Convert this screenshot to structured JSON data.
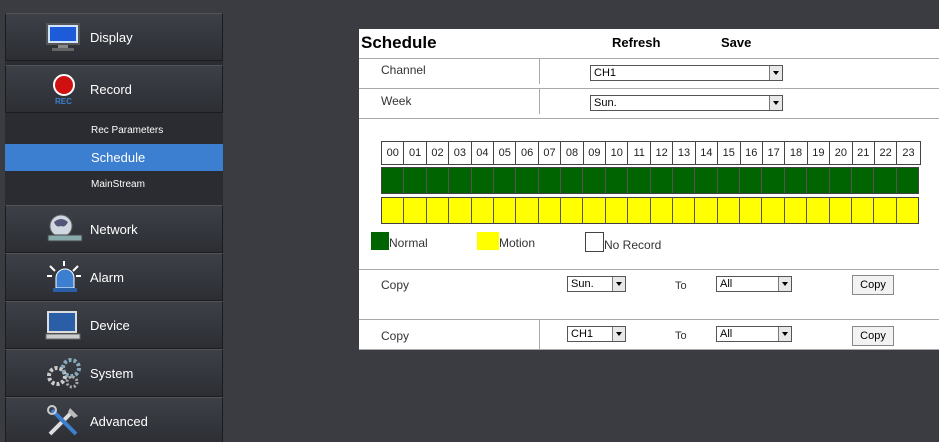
{
  "sidebar": {
    "items": [
      {
        "label": "Display",
        "icon": "monitor-icon"
      },
      {
        "label": "Record",
        "icon": "record-icon",
        "icon_text": "REC"
      },
      {
        "label": "Network",
        "icon": "network-icon"
      },
      {
        "label": "Alarm",
        "icon": "alarm-icon"
      },
      {
        "label": "Device",
        "icon": "device-icon"
      },
      {
        "label": "System",
        "icon": "gears-icon"
      },
      {
        "label": "Advanced",
        "icon": "tools-icon"
      }
    ],
    "sub_items": [
      {
        "label": "Rec Parameters"
      },
      {
        "label": "Schedule",
        "active": true
      },
      {
        "label": "MainStream"
      }
    ]
  },
  "header": {
    "title": "Schedule",
    "refresh_label": "Refresh",
    "save_label": "Save"
  },
  "channel": {
    "label": "Channel",
    "value": "CH1"
  },
  "week": {
    "label": "Week",
    "value": "Sun."
  },
  "hours": [
    "00",
    "01",
    "02",
    "03",
    "04",
    "05",
    "06",
    "07",
    "08",
    "09",
    "10",
    "11",
    "12",
    "13",
    "14",
    "15",
    "16",
    "17",
    "18",
    "19",
    "20",
    "21",
    "22",
    "23"
  ],
  "schedule": {
    "normal_hours_active": 24,
    "motion_hours_active": 24
  },
  "legend": {
    "normal": "Normal",
    "motion": "Motion",
    "no_record": "No Record"
  },
  "colors": {
    "normal": "#006400",
    "motion": "#ffff00",
    "active_sidebar": "#3c7fd0"
  },
  "copy_day": {
    "label": "Copy",
    "from": "Sun.",
    "to_label": "To",
    "to": "All",
    "button": "Copy"
  },
  "copy_channel": {
    "label": "Copy",
    "from": "CH1",
    "to_label": "To",
    "to": "All",
    "button": "Copy"
  }
}
